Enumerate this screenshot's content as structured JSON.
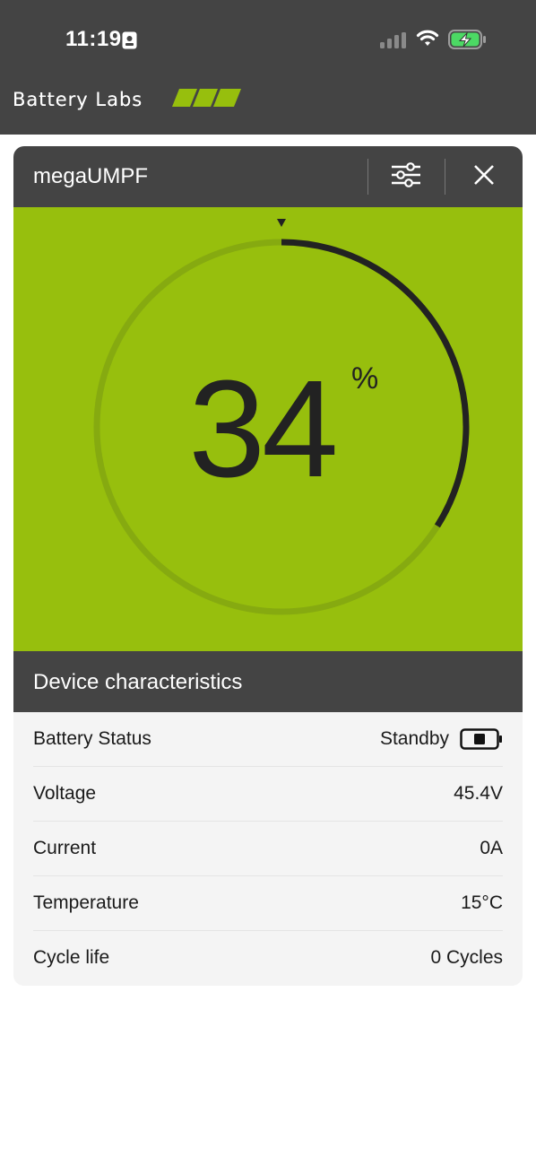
{
  "status_bar": {
    "time": "11:19",
    "icons": [
      "id-card-icon",
      "cellular-signal-icon",
      "wifi-icon",
      "charging-battery-icon"
    ]
  },
  "brand": {
    "name": "Battery Labs",
    "accent": "#97bf0d"
  },
  "card": {
    "device_name": "megaUMPF",
    "buttons": [
      "sliders-icon",
      "close-icon"
    ],
    "gauge": {
      "value": "34",
      "unit": "%",
      "fraction": 0.34,
      "background": "#97bf0d",
      "track_color": "#86aa10",
      "progress_color": "#222222"
    },
    "characteristics": {
      "title": "Device characteristics",
      "rows": [
        {
          "label": "Battery Status",
          "value": "Standby",
          "icon": "battery-standby-icon"
        },
        {
          "label": "Voltage",
          "value": "45.4V"
        },
        {
          "label": "Current",
          "value": "0A"
        },
        {
          "label": "Temperature",
          "value": "15°C"
        },
        {
          "label": "Cycle life",
          "value": "0 Cycles"
        }
      ]
    }
  },
  "colors": {
    "header": "#444444",
    "card_body": "#f4f4f4",
    "page": "#ffffff"
  }
}
